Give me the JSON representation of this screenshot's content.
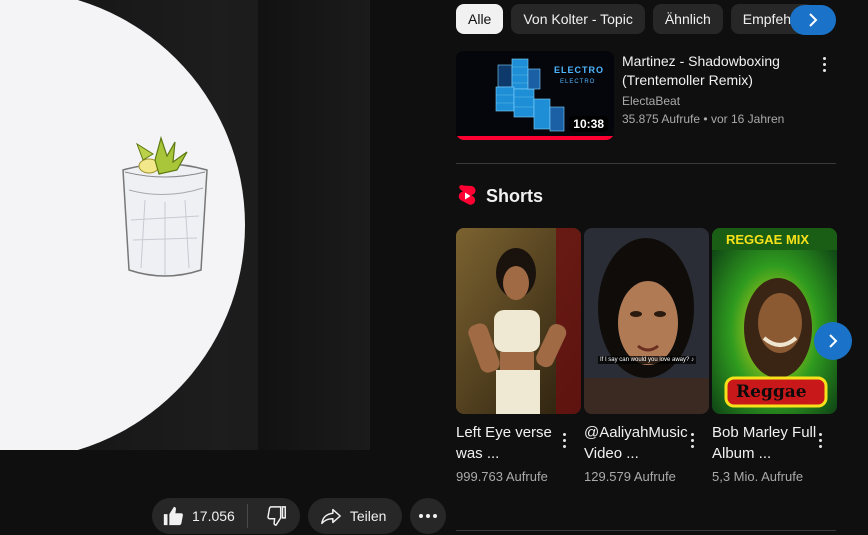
{
  "player": {
    "likes": "17.056",
    "share_label": "Teilen"
  },
  "chips": [
    "Alle",
    "Von Kolter - Topic",
    "Ähnlich",
    "Empfehlu"
  ],
  "recommended": {
    "title": "Martinez - Shadowboxing (Trentemoller Remix)",
    "channel": "ElectaBeat",
    "views": "35.875 Aufrufe",
    "age": "vor 16 Jahren",
    "duration": "10:38",
    "thumb_text_1": "ELECTRO",
    "thumb_text_2": "ELECTRO"
  },
  "shorts": {
    "heading": "Shorts",
    "items": [
      {
        "title": "Left Eye verse was ...",
        "views": "999.763 Aufrufe"
      },
      {
        "title": "@AaliyahMusicVideo ...",
        "views": "129.579 Aufrufe",
        "caption": "If I say can would you love away? ♪"
      },
      {
        "title": "Bob Marley Full Album ...",
        "views": "5,3 Mio. Aufrufe",
        "banner": "REGGAE MIX",
        "badge": "Reggae"
      }
    ]
  },
  "colors": {
    "accent": "#1a73c8",
    "shorts_red": "#ff0033",
    "background": "#0f0f0f"
  }
}
